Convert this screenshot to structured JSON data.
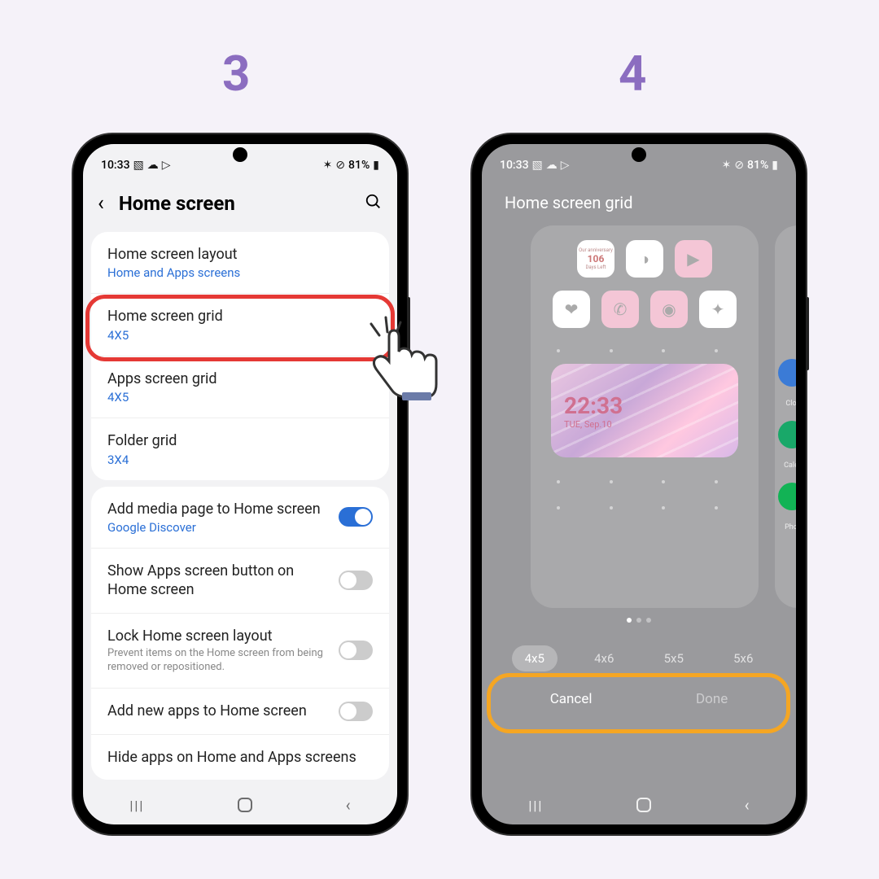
{
  "steps": {
    "left": "3",
    "right": "4"
  },
  "status": {
    "time": "10:33",
    "battery": "81%"
  },
  "left": {
    "header": {
      "title": "Home screen"
    },
    "rows": {
      "layout": {
        "label": "Home screen layout",
        "value": "Home and Apps screens"
      },
      "home_grid": {
        "label": "Home screen grid",
        "value": "4X5"
      },
      "apps_grid": {
        "label": "Apps screen grid",
        "value": "4X5"
      },
      "folder_grid": {
        "label": "Folder grid",
        "value": "3X4"
      },
      "media_page": {
        "label": "Add media page to Home screen",
        "value": "Google Discover",
        "toggle": true
      },
      "show_apps_button": {
        "label": "Show Apps screen button on Home screen",
        "toggle": false
      },
      "lock_layout": {
        "label": "Lock Home screen layout",
        "desc": "Prevent items on the Home screen from being removed or repositioned.",
        "toggle": false
      },
      "add_new_apps": {
        "label": "Add new apps to Home screen",
        "toggle": false
      },
      "hide_apps": {
        "label": "Hide apps on Home and Apps screens"
      }
    }
  },
  "right": {
    "title": "Home screen grid",
    "widget": {
      "time": "22:33",
      "date": "TUE, Sep.10"
    },
    "countdown": {
      "top": "Our anniversary",
      "num": "106",
      "bottom": "Days Left"
    },
    "side_labels": {
      "clock": "Clo",
      "calendar": "Cale",
      "phone": "Pho"
    },
    "options": {
      "o1": "4x5",
      "o2": "4x6",
      "o3": "5x5",
      "o4": "5x6"
    },
    "actions": {
      "cancel": "Cancel",
      "done": "Done"
    }
  }
}
